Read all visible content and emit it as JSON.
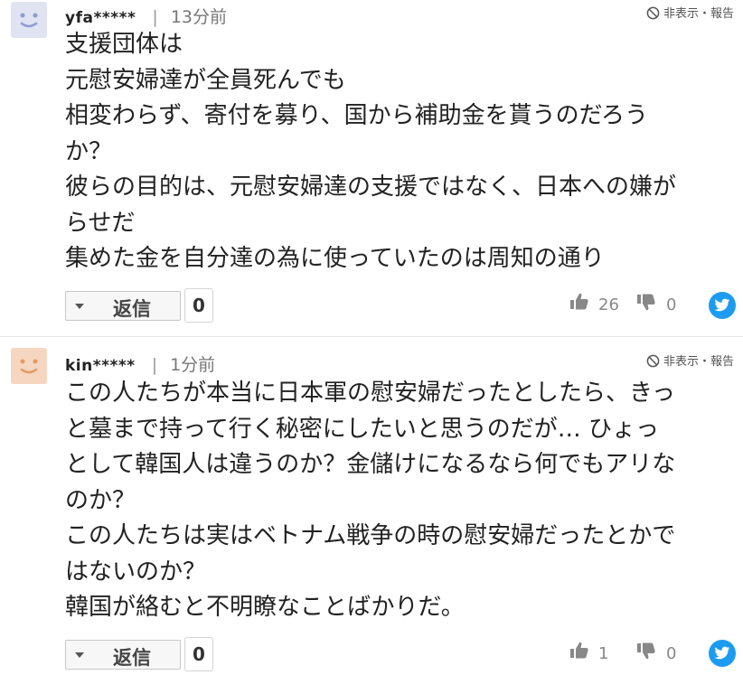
{
  "comments": [
    {
      "username": "yfa*****",
      "separator": "|",
      "time": "13分前",
      "report": "非表示・報告",
      "lines": [
        "支援団体は",
        "元慰安婦達が全員死んでも",
        "相変わらず、寄付を募り、国から補助金を貰うのだろう",
        "か？",
        "彼らの目的は、元慰安婦達の支援ではなく、日本への嫌が",
        "らせだ",
        "集めた金を自分達の為に使っていたのは周知の通り"
      ],
      "reply_label": "返信",
      "reply_count": "0",
      "likes": "26",
      "dislikes": "0",
      "avatar_color": "#dfe3f2"
    },
    {
      "username": "kin*****",
      "separator": "|",
      "time": "1分前",
      "report": "非表示・報告",
      "lines": [
        "この人たちが本当に日本軍の慰安婦だったとしたら、きっ",
        "と墓まで持って行く秘密にしたいと思うのだが… ひょっ",
        "として韓国人は違うのか？金儲けになるなら何でもアリな",
        "のか？",
        "この人たちは実はベトナム戦争の時の慰安婦だったとかで",
        "はないのか？",
        "韓国が絡むと不明瞭なことばかりだ。"
      ],
      "reply_label": "返信",
      "reply_count": "0",
      "likes": "1",
      "dislikes": "0",
      "avatar_color": "#f6d6c0"
    }
  ],
  "icons": {
    "like": "thumbs-up-icon",
    "dislike": "thumbs-down-icon",
    "share": "twitter-icon",
    "report": "ban-icon"
  },
  "colors": {
    "twitter": "#1d9bf0",
    "text": "#222222"
  }
}
